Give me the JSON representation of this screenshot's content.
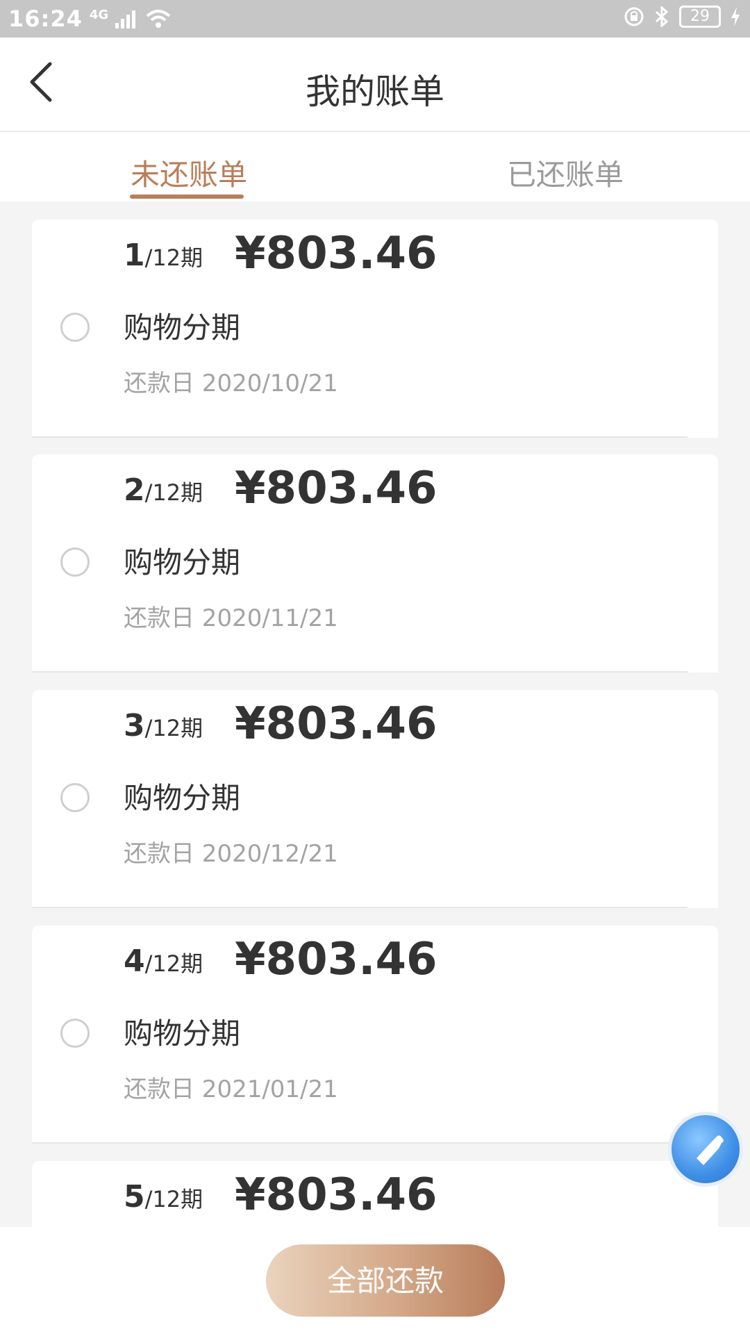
{
  "status_bar": {
    "time": "16:24",
    "network": "4G",
    "battery": "29"
  },
  "header": {
    "title": "我的账单"
  },
  "tabs": [
    {
      "label": "未还账单",
      "active": true
    },
    {
      "label": "已还账单",
      "active": false
    }
  ],
  "bills": [
    {
      "period_current": "1",
      "period_total": "/12期",
      "amount": "¥803.46",
      "type": "购物分期",
      "due_date": "还款日 2020/10/21"
    },
    {
      "period_current": "2",
      "period_total": "/12期",
      "amount": "¥803.46",
      "type": "购物分期",
      "due_date": "还款日 2020/11/21"
    },
    {
      "period_current": "3",
      "period_total": "/12期",
      "amount": "¥803.46",
      "type": "购物分期",
      "due_date": "还款日 2020/12/21"
    },
    {
      "period_current": "4",
      "period_total": "/12期",
      "amount": "¥803.46",
      "type": "购物分期",
      "due_date": "还款日 2021/01/21"
    },
    {
      "period_current": "5",
      "period_total": "/12期",
      "amount": "¥803.46",
      "type": "",
      "due_date": ""
    }
  ],
  "bottom": {
    "pay_all_label": "全部还款"
  },
  "colors": {
    "accent": "#b97e5a",
    "text_primary": "#333333",
    "text_secondary": "#a3a3a3"
  }
}
